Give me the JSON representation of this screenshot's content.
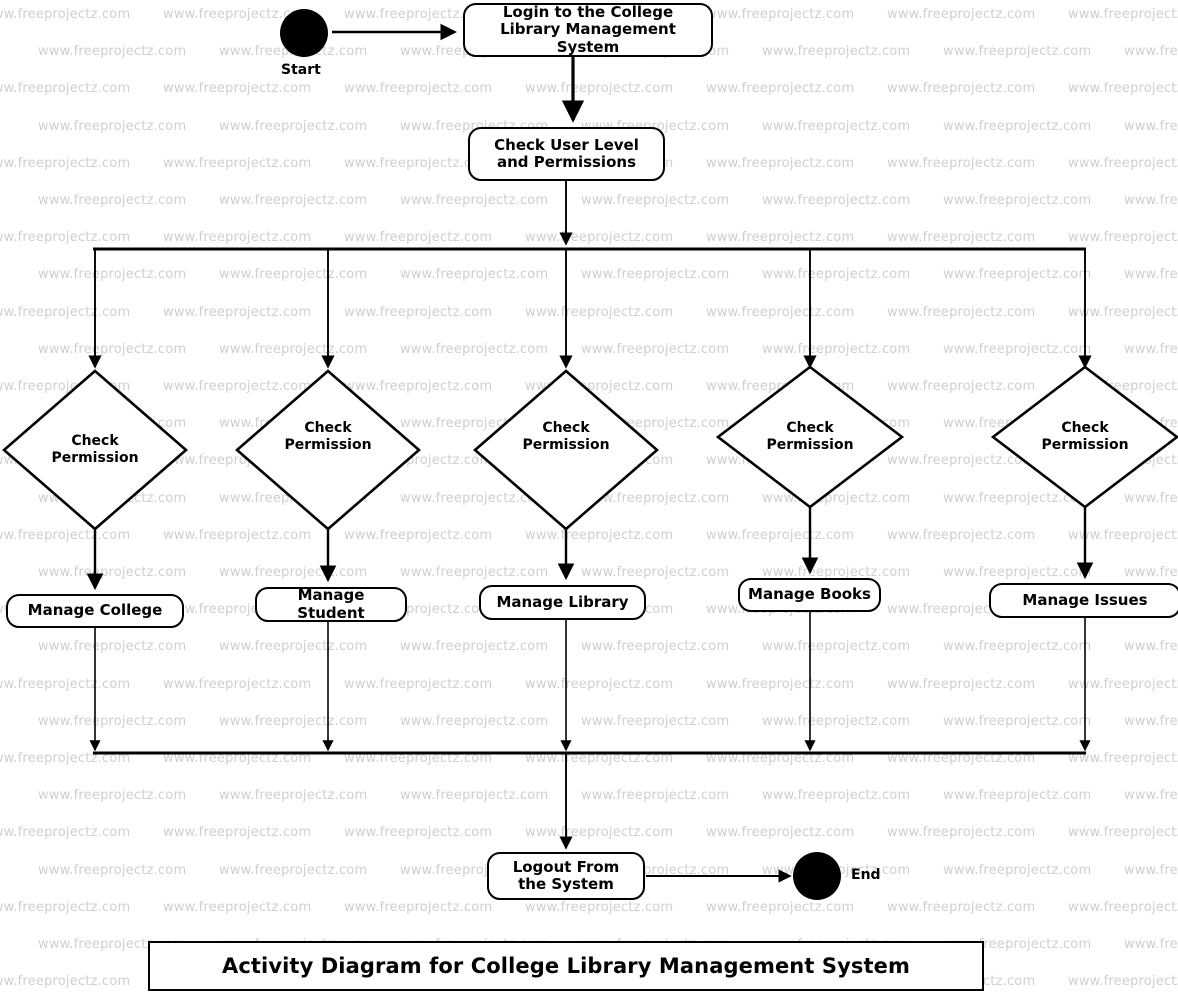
{
  "diagram": {
    "caption": "Activity Diagram for College Library Management System",
    "start_label": "Start",
    "end_label": "End",
    "nodes": {
      "login": "Login to the College Library Management System",
      "check_user": "Check User Level and Permissions",
      "logout": "Logout From the System"
    },
    "decisions": [
      {
        "label": "Check Permission"
      },
      {
        "label": "Check Permission"
      },
      {
        "label": "Check Permission"
      },
      {
        "label": "Check Permission"
      },
      {
        "label": "Check Permission"
      }
    ],
    "actions": [
      {
        "label": "Manage College"
      },
      {
        "label": "Manage Student"
      },
      {
        "label": "Manage Library"
      },
      {
        "label": "Manage Books"
      },
      {
        "label": "Manage Issues"
      }
    ]
  },
  "watermark": {
    "text": "www.freeprojectz.com",
    "color": "#cfcfcf"
  },
  "colors": {
    "stroke": "#000000",
    "fill": "#ffffff",
    "terminal": "#000000"
  }
}
